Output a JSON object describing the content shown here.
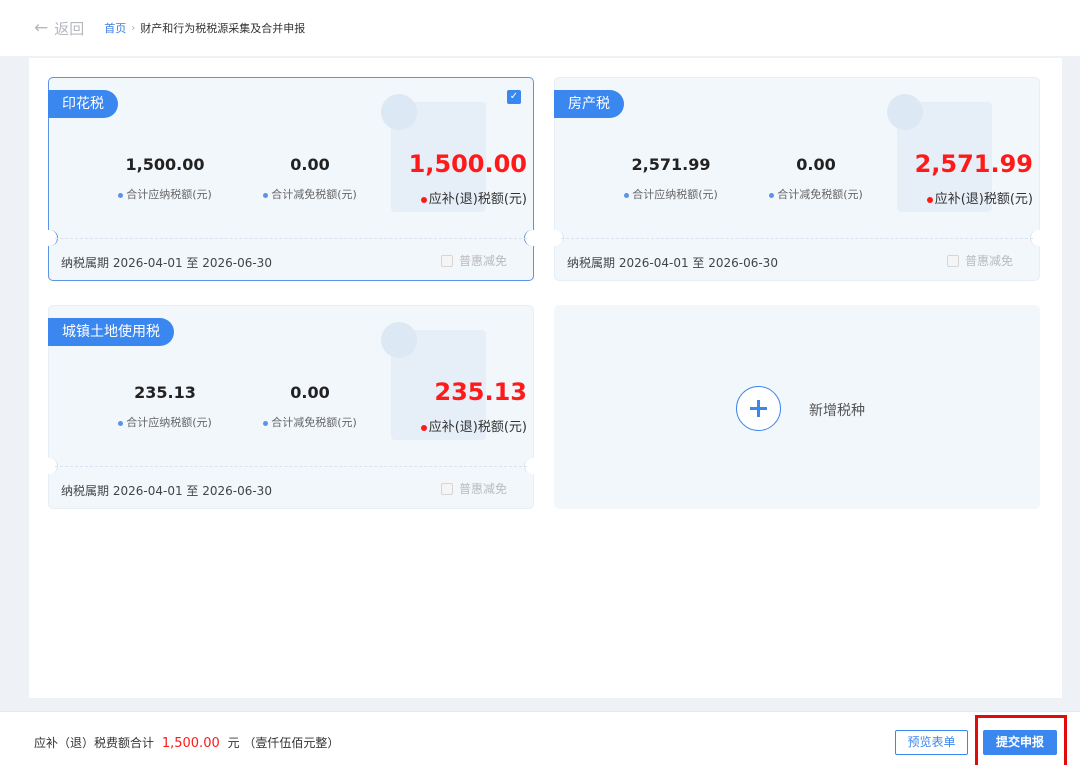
{
  "header": {
    "back_label": "返回",
    "breadcrumb_home": "首页",
    "breadcrumb_sep": "›",
    "breadcrumb_current": "财产和行为税税源采集及合并申报"
  },
  "labels": {
    "payable": "合计应纳税额(元)",
    "exempt": "合计减免税额(元)",
    "refund": "应补(退)税额(元)",
    "period_prefix": "纳税属期",
    "relief": "普惠减免"
  },
  "cards": [
    {
      "name": "印花税",
      "payable": "1,500.00",
      "exempt": "0.00",
      "refund": "1,500.00",
      "period": "2026-04-01 至 2026-06-30",
      "selected": true
    },
    {
      "name": "房产税",
      "payable": "2,571.99",
      "exempt": "0.00",
      "refund": "2,571.99",
      "period": "2026-04-01 至 2026-06-30",
      "selected": false
    },
    {
      "name": "城镇土地使用税",
      "payable": "235.13",
      "exempt": "0.00",
      "refund": "235.13",
      "period": "2026-04-01 至 2026-06-30",
      "selected": false
    }
  ],
  "add_card": {
    "label": "新增税种",
    "icon": "plus-circle-icon"
  },
  "footer": {
    "sum_prefix": "应补（退）税费额合计",
    "sum_amount": "1,500.00",
    "sum_unit": "元",
    "sum_words": "（壹仟伍佰元整）",
    "preview_label": "预览表单",
    "submit_label": "提交申报"
  },
  "colors": {
    "accent": "#3b87f0",
    "amount_red": "#ff1a1a",
    "highlight_frame": "#e10b0b"
  }
}
